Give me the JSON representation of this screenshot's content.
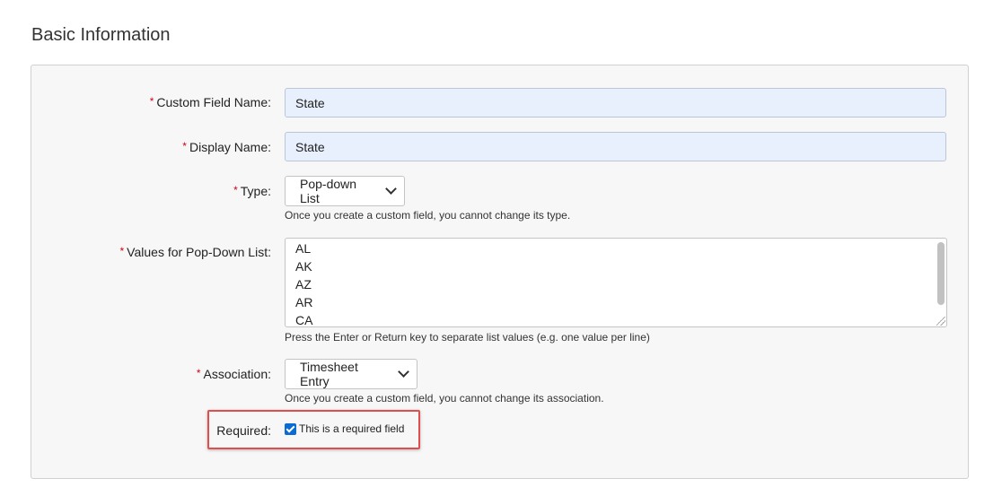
{
  "section": {
    "title": "Basic Information"
  },
  "form": {
    "custom_field_name": {
      "label": "Custom Field Name:",
      "value": "State",
      "required_marker": "*"
    },
    "display_name": {
      "label": "Display Name:",
      "value": "State",
      "required_marker": "*"
    },
    "type": {
      "label": "Type:",
      "required_marker": "*",
      "selected": "Pop-down List",
      "help": "Once you create a custom field, you cannot change its type."
    },
    "values": {
      "label": "Values for Pop-Down List:",
      "required_marker": "*",
      "items": [
        "AL",
        "AK",
        "AZ",
        "AR",
        "CA"
      ],
      "help": "Press the Enter or Return key to separate list values (e.g. one value per line)"
    },
    "association": {
      "label": "Association:",
      "required_marker": "*",
      "selected": "Timesheet Entry",
      "help": "Once you create a custom field, you cannot change its association."
    },
    "required": {
      "label": "Required:",
      "checkbox_label": "This is a required field",
      "checked": true
    }
  },
  "colors": {
    "required_marker": "#d0021b",
    "input_bg": "#e8f0fe",
    "highlight_border": "#e04e4e",
    "checkbox": "#0b6bd3"
  }
}
